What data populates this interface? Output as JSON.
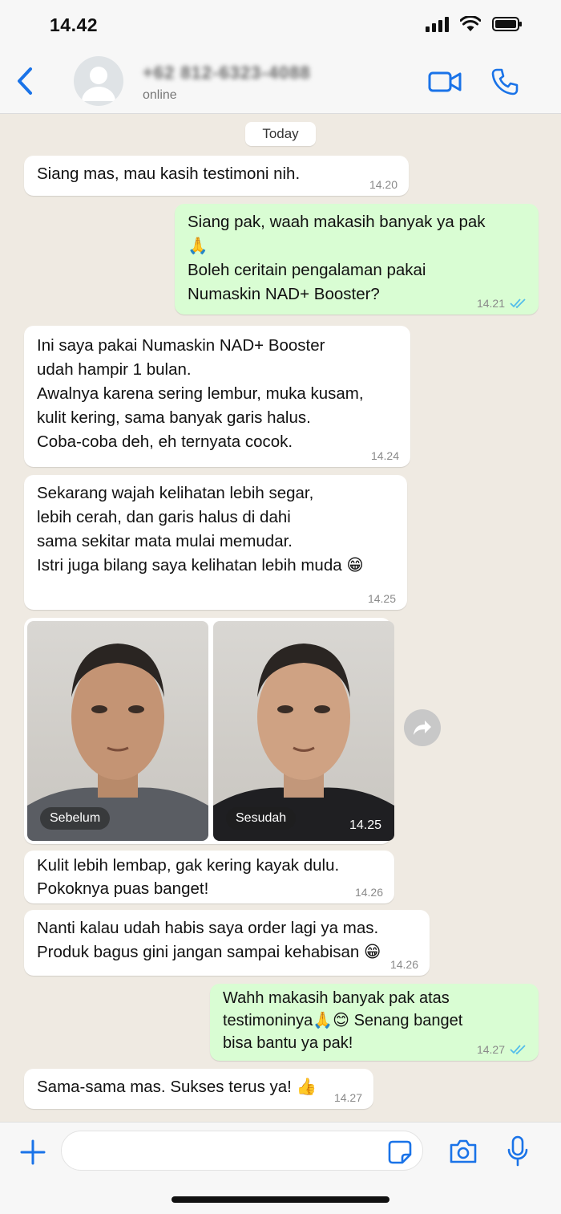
{
  "status_bar": {
    "time": "14.42"
  },
  "header": {
    "contact_name": "+62 812-6323-4088",
    "contact_status": "online"
  },
  "chat": {
    "day_label": "Today",
    "messages": [
      {
        "dir": "in",
        "text": "Siang mas, mau kasih testimoni nih.",
        "time": "14.20"
      },
      {
        "dir": "out",
        "text": "Siang pak, waah makasih banyak ya pak\n🙏\nBoleh ceritain pengalaman pakai\nNumaskin NAD+ Booster?",
        "time": "14.21",
        "read": true
      },
      {
        "dir": "in",
        "text": "Ini saya pakai Numaskin NAD+ Booster\nudah hampir 1 bulan.\nAwalnya karena sering lembur, muka kusam,\nkulit kering, sama banyak garis halus.\nCoba-coba deh, eh ternyata cocok.",
        "time": "14.24"
      },
      {
        "dir": "in",
        "text": "Sekarang wajah kelihatan lebih segar,\nlebih cerah, dan garis halus di dahi\nsama sekitar mata mulai memudar.\nIstri juga bilang saya kelihatan lebih muda 😁",
        "time": "14.25"
      },
      {
        "dir": "in",
        "text": "Kulit lebih lembap, gak kering kayak dulu.\nPokoknya puas banget!",
        "time": "14.26"
      },
      {
        "dir": "in",
        "text": "Nanti kalau udah habis saya order lagi ya mas.\nProduk bagus gini jangan sampai kehabisan 😁",
        "time": "14.26"
      },
      {
        "dir": "out",
        "text": "Wahh makasih banyak pak atas\ntestimoninya🙏😊 Senang banget\nbisa bantu ya pak!",
        "time": "14.27",
        "read": true
      },
      {
        "dir": "in",
        "text": "Sama-sama mas. Sukses terus ya! 👍",
        "time": "14.27"
      }
    ],
    "photo_message": {
      "before_label": "Sebelum",
      "after_label": "Sesudah",
      "time": "14.25"
    }
  },
  "input_bar": {
    "placeholder": ""
  },
  "colors": {
    "accent": "#1a73e8",
    "incoming_bubble": "#ffffff",
    "outgoing_bubble": "#d9fdd3",
    "chat_background": "#efeae2",
    "read_tick": "#53bdeb"
  },
  "icons": [
    "back-chevron-icon",
    "avatar-icon",
    "video-call-icon",
    "phone-icon",
    "forward-icon",
    "plus-icon",
    "sticker-icon",
    "camera-icon",
    "mic-icon",
    "signal-icon",
    "wifi-icon",
    "battery-icon"
  ]
}
